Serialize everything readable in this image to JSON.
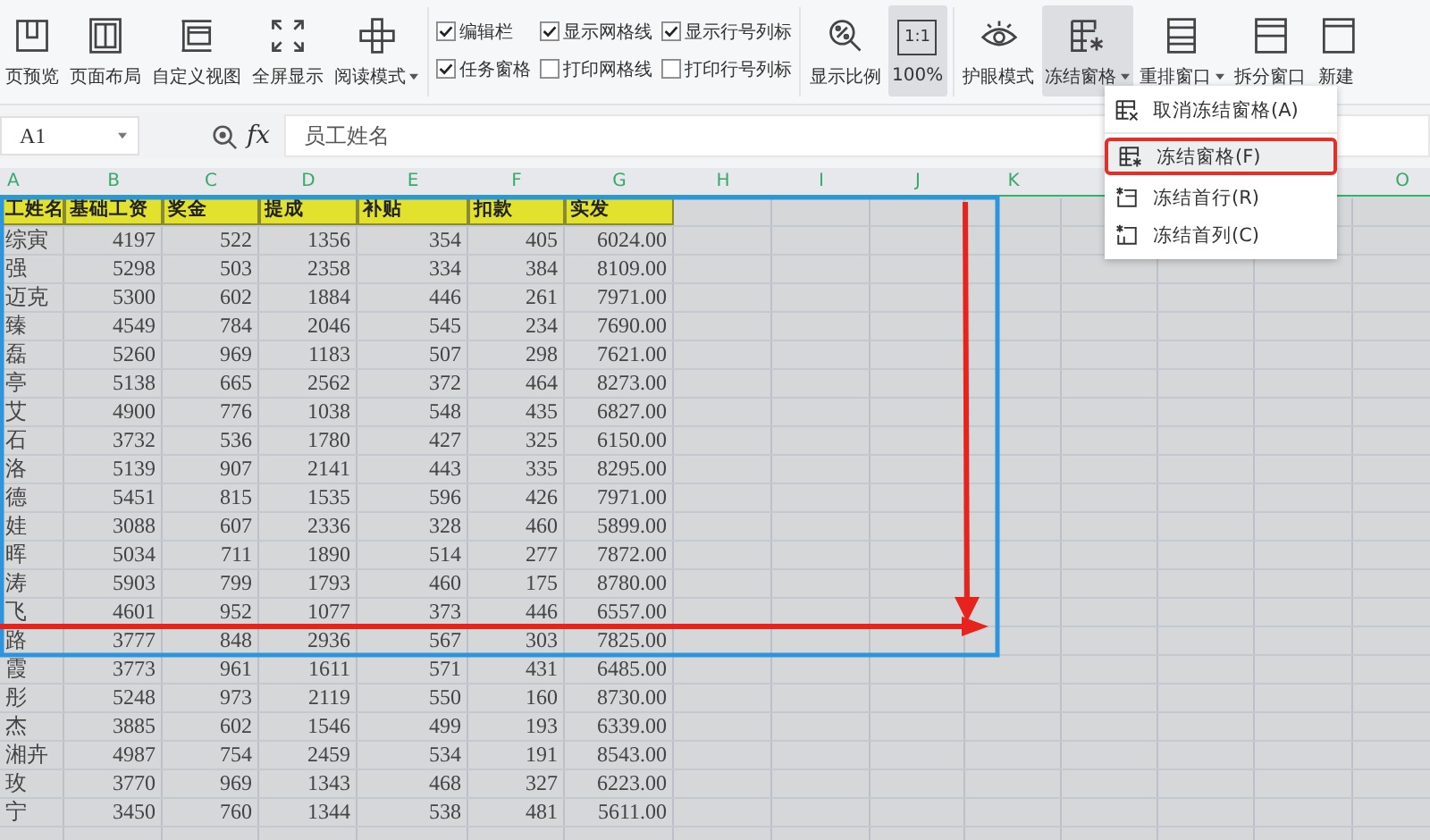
{
  "toolbar": {
    "left_buttons": [
      {
        "label": "页预览",
        "dropdown": false
      },
      {
        "label": "页面布局",
        "dropdown": false
      },
      {
        "label": "自定义视图",
        "dropdown": false
      },
      {
        "label": "全屏显示",
        "dropdown": false
      },
      {
        "label": "阅读模式",
        "dropdown": true
      }
    ],
    "checkboxes": [
      {
        "label": "编辑栏",
        "checked": true
      },
      {
        "label": "任务窗格",
        "checked": true
      },
      {
        "label": "显示网格线",
        "checked": true
      },
      {
        "label": "打印网格线",
        "checked": false
      },
      {
        "label": "显示行号列标",
        "checked": true
      },
      {
        "label": "打印行号列标",
        "checked": false
      }
    ],
    "right_buttons": [
      {
        "label": "显示比例",
        "dropdown": false,
        "pressed": false
      },
      {
        "label": "100%",
        "icon_text": "1:1",
        "dropdown": false,
        "pressed": true
      },
      {
        "label": "护眼模式",
        "dropdown": false,
        "pressed": false
      },
      {
        "label": "冻结窗格",
        "dropdown": true,
        "pressed": true
      },
      {
        "label": "重排窗口",
        "dropdown": true,
        "pressed": false
      },
      {
        "label": "拆分窗口",
        "dropdown": false,
        "pressed": false
      },
      {
        "label": "新建",
        "dropdown": false,
        "pressed": false
      }
    ]
  },
  "formula_bar": {
    "cell_ref": "A1",
    "function_label": "fx",
    "formula": "员工姓名"
  },
  "freeze_menu": {
    "items": [
      {
        "label": "取消冻结窗格(A)",
        "selected": false
      },
      {
        "label": "冻结窗格(F)",
        "selected": true
      },
      {
        "label": "冻结首行(R)",
        "selected": false
      },
      {
        "label": "冻结首列(C)",
        "selected": false
      }
    ]
  },
  "sheet": {
    "columns": [
      {
        "letter": "A"
      },
      {
        "letter": "B"
      },
      {
        "letter": "C"
      },
      {
        "letter": "D"
      },
      {
        "letter": "E"
      },
      {
        "letter": "F"
      },
      {
        "letter": "G"
      },
      {
        "letter": "H"
      },
      {
        "letter": "I"
      },
      {
        "letter": "J"
      },
      {
        "letter": "K"
      },
      {},
      {},
      {},
      {
        "letter": "O"
      }
    ],
    "header": [
      "工姓名",
      "基础工资",
      "奖金",
      "提成",
      "补贴",
      "扣款",
      "实发"
    ],
    "rows": [
      [
        "综寅",
        "4197",
        "522",
        "1356",
        "354",
        "405",
        "6024.00"
      ],
      [
        "强",
        "5298",
        "503",
        "2358",
        "334",
        "384",
        "8109.00"
      ],
      [
        "迈克",
        "5300",
        "602",
        "1884",
        "446",
        "261",
        "7971.00"
      ],
      [
        "臻",
        "4549",
        "784",
        "2046",
        "545",
        "234",
        "7690.00"
      ],
      [
        "磊",
        "5260",
        "969",
        "1183",
        "507",
        "298",
        "7621.00"
      ],
      [
        "亭",
        "5138",
        "665",
        "2562",
        "372",
        "464",
        "8273.00"
      ],
      [
        "艾",
        "4900",
        "776",
        "1038",
        "548",
        "435",
        "6827.00"
      ],
      [
        "石",
        "3732",
        "536",
        "1780",
        "427",
        "325",
        "6150.00"
      ],
      [
        "洛",
        "5139",
        "907",
        "2141",
        "443",
        "335",
        "8295.00"
      ],
      [
        "德",
        "5451",
        "815",
        "1535",
        "596",
        "426",
        "7971.00"
      ],
      [
        "娃",
        "3088",
        "607",
        "2336",
        "328",
        "460",
        "5899.00"
      ],
      [
        "晖",
        "5034",
        "711",
        "1890",
        "514",
        "277",
        "7872.00"
      ],
      [
        "涛",
        "5903",
        "799",
        "1793",
        "460",
        "175",
        "8780.00"
      ],
      [
        "飞",
        "4601",
        "952",
        "1077",
        "373",
        "446",
        "6557.00"
      ],
      [
        "路",
        "3777",
        "848",
        "2936",
        "567",
        "303",
        "7825.00"
      ],
      [
        "霞",
        "3773",
        "961",
        "1611",
        "571",
        "431",
        "6485.00"
      ],
      [
        "彤",
        "5248",
        "973",
        "2119",
        "550",
        "160",
        "8730.00"
      ],
      [
        "杰",
        "3885",
        "602",
        "1546",
        "499",
        "193",
        "6339.00"
      ],
      [
        "湘卉",
        "4987",
        "754",
        "2459",
        "534",
        "191",
        "8543.00"
      ],
      [
        "玫",
        "3770",
        "969",
        "1343",
        "468",
        "327",
        "6223.00"
      ],
      [
        "宁",
        "3450",
        "760",
        "1344",
        "538",
        "481",
        "5611.00"
      ]
    ]
  }
}
